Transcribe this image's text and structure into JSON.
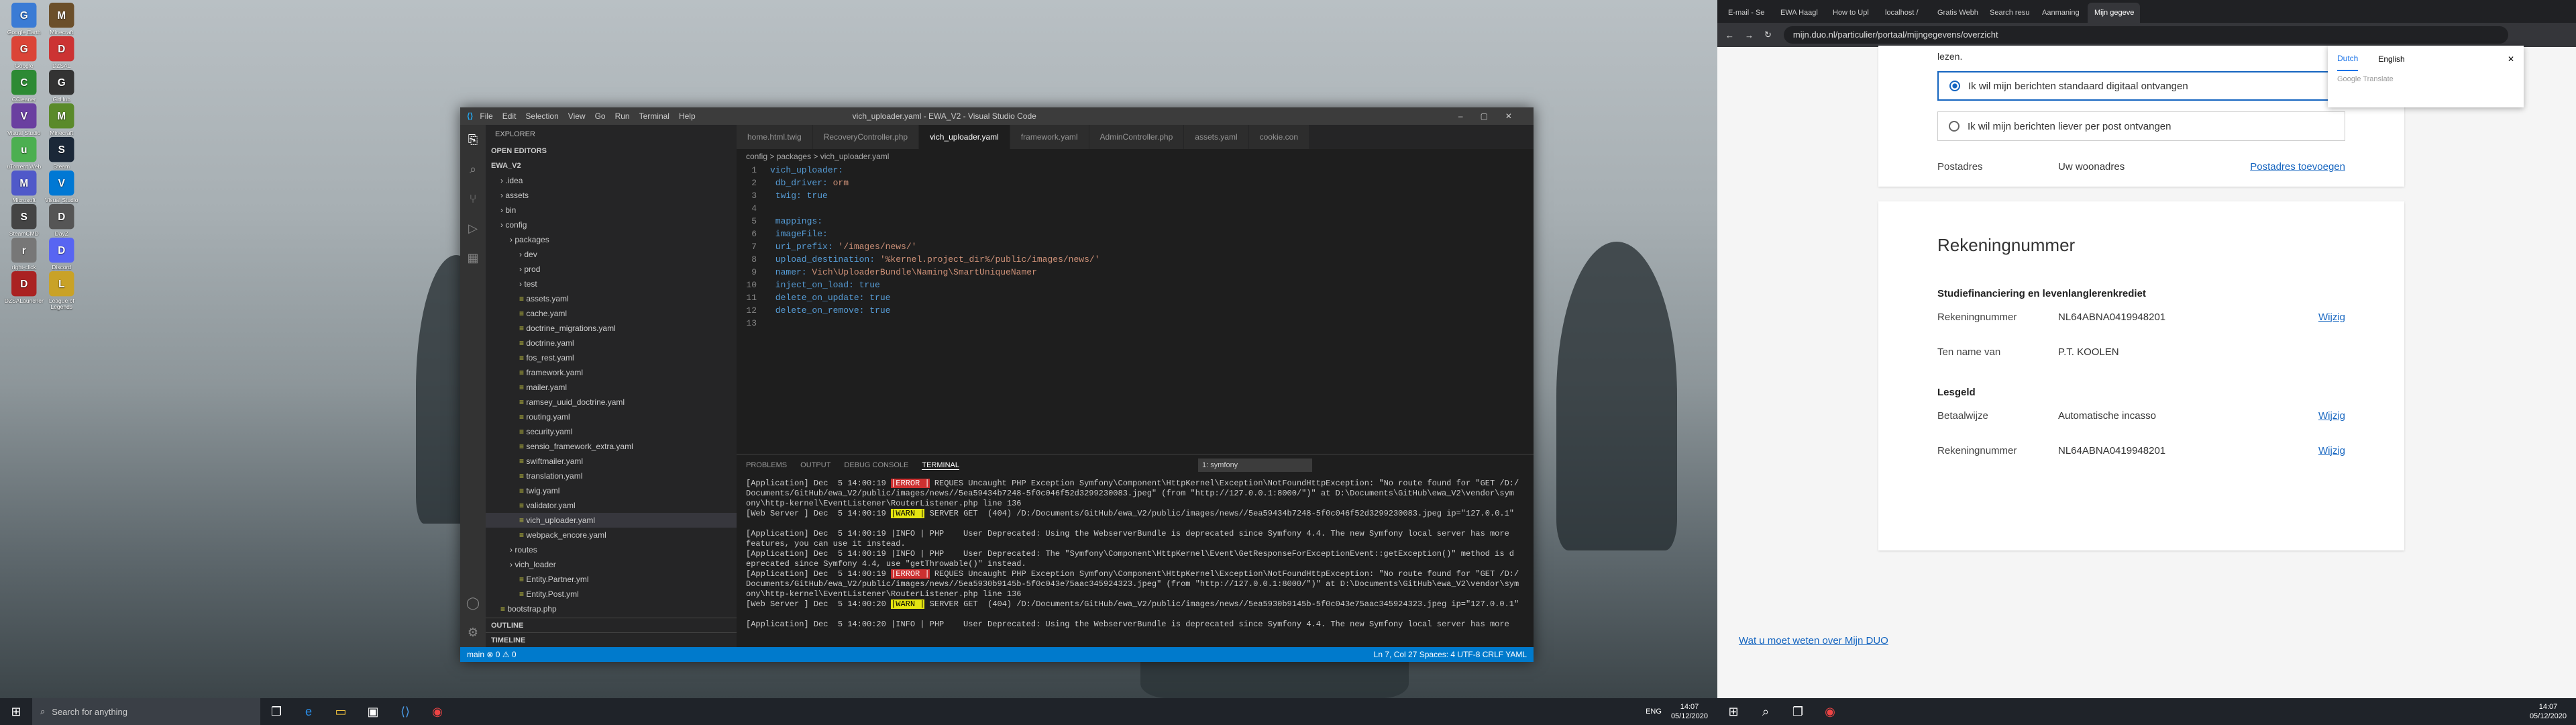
{
  "desktop": {
    "icons": [
      "Google Earth",
      "Minecraft",
      "Google Chrome",
      "DZSAL",
      "CCleaner",
      "GitHub Desktop",
      "Visual Studio",
      "Minecraft Launcher",
      "uTorrent Web",
      "Steam",
      "Microsoft Teams",
      "Visual Studio Code",
      "SteamCMD",
      "DayZ",
      "right-click",
      "Discord",
      "DZSALauncher",
      "League of Legends"
    ]
  },
  "vscode": {
    "title": "vich_uploader.yaml - EWA_V2 - Visual Studio Code",
    "menu": [
      "File",
      "Edit",
      "Selection",
      "View",
      "Go",
      "Run",
      "Terminal",
      "Help"
    ],
    "explorer_label": "EXPLORER",
    "open_editors": "OPEN EDITORS",
    "project": "EWA_V2",
    "tree": [
      ".idea",
      "assets",
      "bin",
      "config",
      "packages",
      "dev",
      "prod",
      "test",
      "assets.yaml",
      "cache.yaml",
      "doctrine_migrations.yaml",
      "doctrine.yaml",
      "fos_rest.yaml",
      "framework.yaml",
      "mailer.yaml",
      "ramsey_uuid_doctrine.yaml",
      "routing.yaml",
      "security.yaml",
      "sensio_framework_extra.yaml",
      "swiftmailer.yaml",
      "translation.yaml",
      "twig.yaml",
      "validator.yaml",
      "vich_uploader.yaml",
      "webpack_encore.yaml",
      "routes",
      "vich_loader",
      "Entity.Partner.yml",
      "Entity.Post.yml",
      "bootstrap.php"
    ],
    "outline": "OUTLINE",
    "timeline": "TIMELINE",
    "tabs": [
      "home.html.twig",
      "RecoveryController.php",
      "vich_uploader.yaml",
      "framework.yaml",
      "AdminController.php",
      "assets.yaml",
      "cookie.con"
    ],
    "breadcrumb": "config > packages > vich_uploader.yaml",
    "code": [
      "vich_uploader:",
      "    db_driver: orm",
      "    twig: true",
      "",
      "    mappings:",
      "        imageFile:",
      "            uri_prefix: '/images/news/'",
      "            upload_destination: '%kernel.project_dir%/public/images/news/'",
      "            namer: Vich\\UploaderBundle\\Naming\\SmartUniqueNamer",
      "            inject_on_load: true",
      "            delete_on_update: true",
      "            delete_on_remove: true",
      ""
    ],
    "panel_tabs": [
      "PROBLEMS",
      "OUTPUT",
      "DEBUG CONSOLE",
      "TERMINAL"
    ],
    "terminal_select": "1: symfony",
    "terminal": [
      "[Application] Dec  5 14:00:19 |ERROR | REQUES Uncaught PHP Exception Symfony\\Component\\HttpKernel\\Exception\\NotFoundHttpException: \"No route found for \"GET /D:/",
      "Documents/GitHub/ewa_V2/public/images/news//5ea59434b7248-5f0c046f52d3299230083.jpeg\" (from \"http://127.0.0.1:8000/\")\" at D:\\Documents\\GitHub\\ewa_V2\\vendor\\sym",
      "ony\\http-kernel\\EventListener\\RouterListener.php line 136",
      "[Web Server ] Dec  5 14:00:19 |WARN | SERVER GET  (404) /D:/Documents/GitHub/ewa_V2/public/images/news//5ea59434b7248-5f0c046f52d3299230083.jpeg ip=\"127.0.0.1\"",
      "",
      "[Application] Dec  5 14:00:19 |INFO | PHP    User Deprecated: Using the WebserverBundle is deprecated since Symfony 4.4. The new Symfony local server has more",
      "features, you can use it instead.",
      "[Application] Dec  5 14:00:19 |INFO | PHP    User Deprecated: The \"Symfony\\Component\\HttpKernel\\Event\\GetResponseForExceptionEvent::getException()\" method is d",
      "eprecated since Symfony 4.4, use \"getThrowable()\" instead.",
      "[Application] Dec  5 14:00:19 |ERROR | REQUES Uncaught PHP Exception Symfony\\Component\\HttpKernel\\Exception\\NotFoundHttpException: \"No route found for \"GET /D:/",
      "Documents/GitHub/ewa_V2/public/images/news//5ea5930b9145b-5f0c043e75aac345924323.jpeg\" (from \"http://127.0.0.1:8000/\")\" at D:\\Documents\\GitHub\\ewa_V2\\vendor\\sym",
      "ony\\http-kernel\\EventListener\\RouterListener.php line 136",
      "[Web Server ] Dec  5 14:00:20 |WARN | SERVER GET  (404) /D:/Documents/GitHub/ewa_V2/public/images/news//5ea5930b9145b-5f0c043e75aac345924323.jpeg ip=\"127.0.0.1\"",
      "",
      "[Application] Dec  5 14:00:20 |INFO | PHP    User Deprecated: Using the WebserverBundle is deprecated since Symfony 4.4. The new Symfony local server has more"
    ],
    "status_left": "main   ⊗ 0 ⚠ 0",
    "status_right": "Ln 7, Col 27   Spaces: 4   UTF-8   CRLF   YAML"
  },
  "taskbar_left": {
    "search": "Search for anything"
  },
  "taskbar_right": {
    "time": "14:07",
    "date": "05/12/2020",
    "lang": "ENG"
  },
  "browser": {
    "tabs": [
      "E-mail - Se",
      "EWA Haagl",
      "How to Upl",
      "localhost /",
      "Gratis Webh",
      "Search resu",
      "Aanmaning",
      "Mijn gegeve"
    ],
    "url": "mijn.duo.nl/particulier/portaal/mijngegevens/overzicht",
    "lezen": "lezen.",
    "radio1": "Ik wil mijn berichten standaard digitaal ontvangen",
    "radio2": "Ik wil mijn berichten liever per post ontvangen",
    "postadres_label": "Postadres",
    "postadres_value": "Uw woonadres",
    "postadres_link": "Postadres toevoegen",
    "rek_title": "Rekeningnummer",
    "section1": "Studiefinanciering en levenlanglerenkrediet",
    "rek_label": "Rekeningnummer",
    "rek_value": "NL64ABNA0419948201",
    "wijzig": "Wijzig",
    "tnv_label": "Ten name van",
    "tnv_value": "P.T. KOOLEN",
    "section2": "Lesgeld",
    "betaal_label": "Betaalwijze",
    "betaal_value": "Automatische incasso",
    "footer_link": "Wat u moet weten over Mijn DUO",
    "translate_dutch": "Dutch",
    "translate_english": "English",
    "translate_note": "Google Translate"
  }
}
